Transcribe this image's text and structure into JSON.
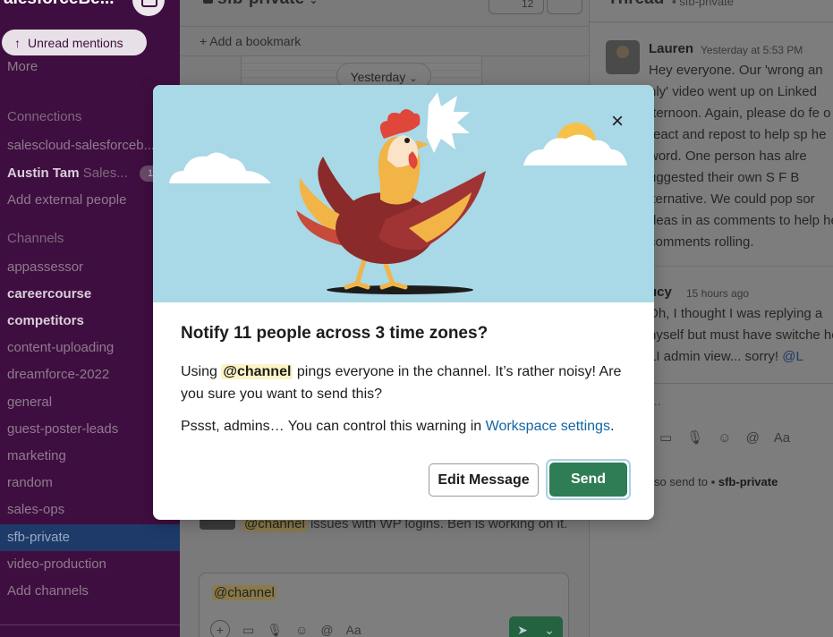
{
  "sidebar": {
    "workspace_name": "alesforceBe...",
    "unread_label": "Unread mentions",
    "more_label": "More",
    "connections_header": "Connections",
    "connection_item": "salescloud-salesforceb...",
    "dm_name": "Austin Tam",
    "dm_status": "Sales...",
    "dm_badge": "1",
    "add_external": "Add external people",
    "channels_header": "Channels",
    "channels": [
      {
        "label": "appassessor",
        "bold": false
      },
      {
        "label": "careercourse",
        "bold": true
      },
      {
        "label": "competitors",
        "bold": true
      },
      {
        "label": "content-uploading",
        "bold": false
      },
      {
        "label": "dreamforce-2022",
        "bold": false
      },
      {
        "label": "general",
        "bold": false
      },
      {
        "label": "guest-poster-leads",
        "bold": false
      },
      {
        "label": "marketing",
        "bold": false
      },
      {
        "label": "random",
        "bold": false
      },
      {
        "label": "sales-ops",
        "bold": false
      },
      {
        "label": "sfb-private",
        "bold": false,
        "active": true
      },
      {
        "label": "video-production",
        "bold": false
      }
    ],
    "add_channels": "Add channels"
  },
  "channel": {
    "title": "sfb-private",
    "member_count": "12",
    "bookmark_label": "+ Add a bookmark",
    "date_divider": "Yesterday",
    "message_mention": "@channel",
    "message_text": " issues with WP logins. Ben is working on it.",
    "composer_text": "@channel",
    "composer_format": "Aa"
  },
  "thread": {
    "title": "Thread",
    "channel": "sfb-private",
    "msg1": {
      "name": "Lauren",
      "time": "Yesterday at 5:53 PM",
      "text": "Hey everyone. Our 'wrong an nly' video went up on Linked fternoon. Again, please do fe o react and repost to help sp he word. One person has alre uggested their own S F B lternative. We could pop sor deas in as comments to help he comments rolling."
    },
    "msg2": {
      "name": "ucy",
      "time": "15 hours ago",
      "text": "Dh, I thought I was replying a nyself but must have switche he LI admin view... sorry! ",
      "link": "@L"
    },
    "reply_placeholder": "...",
    "format_label": "Aa",
    "also_send_prefix": "so send to",
    "also_send_channel": "sfb-private"
  },
  "modal": {
    "title": "Notify 11 people across 3 time zones?",
    "body_prefix": "Using ",
    "body_chip": "@channel",
    "body_suffix": " pings everyone in the channel. It’s rather noisy! Are you sure you want to send this?",
    "note_prefix": "Pssst, admins… You can control this warning in ",
    "note_link": "Workspace settings",
    "note_suffix": ".",
    "close_symbol": "×",
    "edit_button": "Edit Message",
    "send_button": "Send"
  },
  "colors": {
    "sidebar_bg": "#3f0e40",
    "hero_bg": "#a9d8e6",
    "send_green": "#2e7d55",
    "link_blue": "#1264a3",
    "mention_yellow": "#fdf3c4"
  }
}
